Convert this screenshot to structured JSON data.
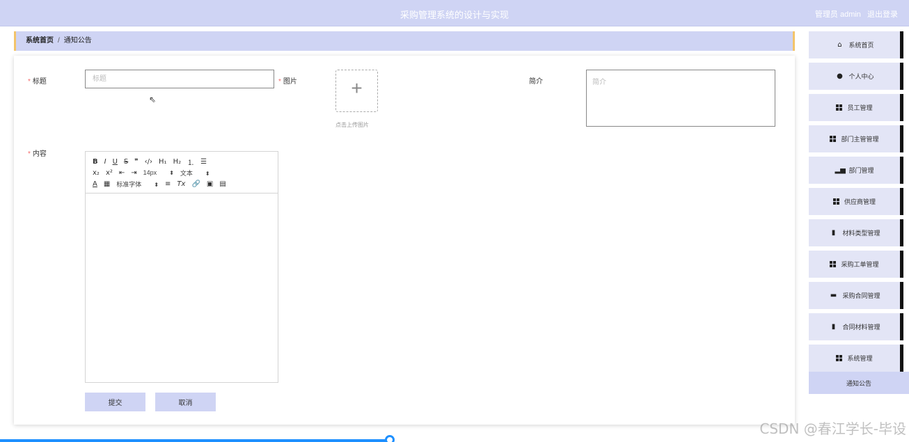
{
  "header": {
    "title": "采购管理系统的设计与实现",
    "role": "管理员 admin",
    "logout": "退出登录"
  },
  "breadcrumb": {
    "home": "系统首页",
    "separator": "/",
    "current": "通知公告"
  },
  "form": {
    "title_label": "标题",
    "title_placeholder": "标题",
    "image_label": "图片",
    "upload_tip": "点击上传图片",
    "intro_label": "简介",
    "intro_placeholder": "简介",
    "content_label": "内容",
    "submit": "提交",
    "cancel": "取消"
  },
  "editor": {
    "font_size": "14px",
    "header_select": "文本",
    "font_family": "标准字体"
  },
  "sidebar": {
    "items": [
      {
        "label": "系统首页",
        "icon": "home-icon"
      },
      {
        "label": "个人中心",
        "icon": "user-icon"
      },
      {
        "label": "员工管理",
        "icon": "grid-icon"
      },
      {
        "label": "部门主管管理",
        "icon": "grid-icon"
      },
      {
        "label": "部门管理",
        "icon": "bar-chart-icon"
      },
      {
        "label": "供应商管理",
        "icon": "grid-icon"
      },
      {
        "label": "材料类型管理",
        "icon": "clipboard-icon"
      },
      {
        "label": "采购工单管理",
        "icon": "grid-icon"
      },
      {
        "label": "采购合同管理",
        "icon": "briefcase-icon"
      },
      {
        "label": "合同材料管理",
        "icon": "clipboard-icon"
      },
      {
        "label": "系统管理",
        "icon": "grid-icon"
      }
    ],
    "active_item": "通知公告"
  },
  "watermark": "CSDN @春江学长-毕设",
  "colors": {
    "header_bg": "#cfd4f4",
    "accent_border": "#f3c46a",
    "required": "#f56c6c",
    "progress": "#1e90ff"
  }
}
